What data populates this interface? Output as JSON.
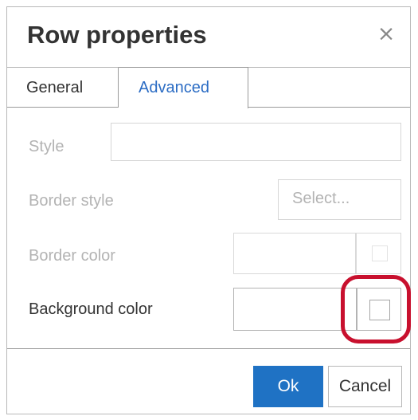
{
  "dialog": {
    "title": "Row properties",
    "close_glyph": "×"
  },
  "tabs": [
    {
      "label": "General",
      "active": false
    },
    {
      "label": "Advanced",
      "active": true
    }
  ],
  "fields": {
    "style": {
      "label": "Style",
      "value": "",
      "enabled": false
    },
    "border_style": {
      "label": "Border style",
      "value": "",
      "placeholder": "Select...",
      "enabled": false
    },
    "border_color": {
      "label": "Border color",
      "value": "",
      "enabled": false
    },
    "background_color": {
      "label": "Background color",
      "value": "",
      "enabled": true
    }
  },
  "buttons": {
    "ok": "Ok",
    "cancel": "Cancel"
  },
  "colors": {
    "primary": "#1f72c4",
    "tab_active_text": "#2b6cc4",
    "highlight_ring": "#c8102e",
    "disabled_text": "#b3b3b3"
  },
  "icons": [
    "close-icon",
    "color-swatch-icon"
  ]
}
